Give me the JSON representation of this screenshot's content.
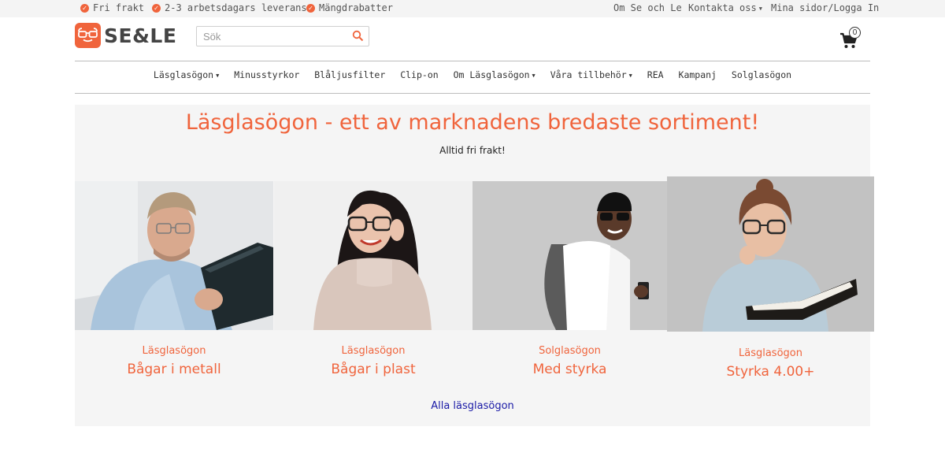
{
  "topbar": {
    "usps": [
      "Fri frakt",
      "2-3 arbetsdagars leverans",
      "Mängdrabatter"
    ],
    "links": [
      "Om Se och Le",
      "Kontakta oss",
      "Mina sidor/Logga In"
    ]
  },
  "header": {
    "logo_text": "SE&LE",
    "search_placeholder": "Sök",
    "cart_count": "0"
  },
  "nav": {
    "items": [
      "Läsglasögon",
      "Minusstyrkor",
      "Blåljusfilter",
      "Clip-on",
      "Om Läsglasögon",
      "Våra tillbehör",
      "REA",
      "Kampanj",
      "Solglasögon"
    ]
  },
  "hero": {
    "title": "Läsglasögon - ett av marknadens bredaste sortiment!",
    "subtitle": "Alltid fri frakt!"
  },
  "categories": [
    {
      "small": "Läsglasögon",
      "big": "Bågar i metall"
    },
    {
      "small": "Läsglasögon",
      "big": "Bågar i plast"
    },
    {
      "small": "Solglasögon",
      "big": "Med styrka"
    },
    {
      "small": "Läsglasögon",
      "big": "Styrka 4.00+"
    }
  ],
  "all_link": "Alla läsglasögon",
  "colors": {
    "accent": "#f0643c",
    "link": "#1a1aa6"
  }
}
